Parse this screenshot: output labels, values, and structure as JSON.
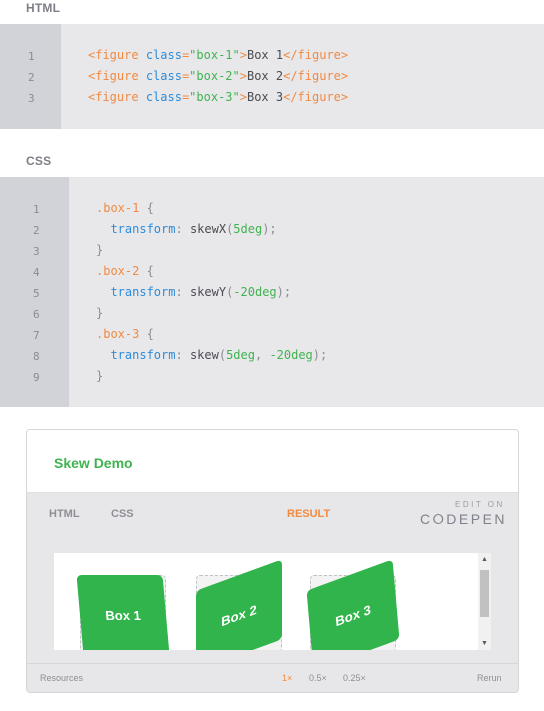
{
  "html_section": {
    "label": "HTML",
    "line_numbers": [
      "1",
      "2",
      "3"
    ],
    "lines": [
      [
        [
          "tok-tag",
          "<figure"
        ],
        [
          "tok-text",
          " "
        ],
        [
          "tok-attr",
          "class"
        ],
        [
          "tok-tag",
          "="
        ],
        [
          "tok-str",
          "\"box-1\""
        ],
        [
          "tok-tag",
          ">"
        ],
        [
          "tok-text",
          "Box 1"
        ],
        [
          "tok-tag",
          "</figure>"
        ]
      ],
      [
        [
          "tok-tag",
          "<figure"
        ],
        [
          "tok-text",
          " "
        ],
        [
          "tok-attr",
          "class"
        ],
        [
          "tok-tag",
          "="
        ],
        [
          "tok-str",
          "\"box-2\""
        ],
        [
          "tok-tag",
          ">"
        ],
        [
          "tok-text",
          "Box 2"
        ],
        [
          "tok-tag",
          "</figure>"
        ]
      ],
      [
        [
          "tok-tag",
          "<figure"
        ],
        [
          "tok-text",
          " "
        ],
        [
          "tok-attr",
          "class"
        ],
        [
          "tok-tag",
          "="
        ],
        [
          "tok-str",
          "\"box-3\""
        ],
        [
          "tok-tag",
          ">"
        ],
        [
          "tok-text",
          "Box 3"
        ],
        [
          "tok-tag",
          "</figure>"
        ]
      ]
    ]
  },
  "css_section": {
    "label": "CSS",
    "line_numbers": [
      "1",
      "2",
      "3",
      "4",
      "5",
      "6",
      "7",
      "8",
      "9"
    ],
    "lines": [
      [
        [
          "tok-sel",
          ".box-1"
        ],
        [
          "tok-punc",
          " {"
        ]
      ],
      [
        [
          "tok-text",
          "  "
        ],
        [
          "tok-prop",
          "transform"
        ],
        [
          "tok-punc",
          ": "
        ],
        [
          "tok-fn",
          "skewX"
        ],
        [
          "tok-punc",
          "("
        ],
        [
          "tok-num",
          "5deg"
        ],
        [
          "tok-punc",
          ");"
        ]
      ],
      [
        [
          "tok-punc",
          "}"
        ]
      ],
      [
        [
          "tok-sel",
          ".box-2"
        ],
        [
          "tok-punc",
          " {"
        ]
      ],
      [
        [
          "tok-text",
          "  "
        ],
        [
          "tok-prop",
          "transform"
        ],
        [
          "tok-punc",
          ": "
        ],
        [
          "tok-fn",
          "skewY"
        ],
        [
          "tok-punc",
          "("
        ],
        [
          "tok-num",
          "-20deg"
        ],
        [
          "tok-punc",
          ");"
        ]
      ],
      [
        [
          "tok-punc",
          "}"
        ]
      ],
      [
        [
          "tok-sel",
          ".box-3"
        ],
        [
          "tok-punc",
          " {"
        ]
      ],
      [
        [
          "tok-text",
          "  "
        ],
        [
          "tok-prop",
          "transform"
        ],
        [
          "tok-punc",
          ": "
        ],
        [
          "tok-fn",
          "skew"
        ],
        [
          "tok-punc",
          "("
        ],
        [
          "tok-num",
          "5deg"
        ],
        [
          "tok-punc",
          ", "
        ],
        [
          "tok-num",
          "-20deg"
        ],
        [
          "tok-punc",
          ");"
        ]
      ],
      [
        [
          "tok-punc",
          "}"
        ]
      ]
    ]
  },
  "demo": {
    "title": "Skew Demo",
    "tabs": {
      "html": "HTML",
      "css": "CSS",
      "result": "RESULT"
    },
    "codepen": {
      "edit_on": "EDIT ON",
      "logo": "C⭘DEPEN"
    },
    "boxes": [
      "Box 1",
      "Box 2",
      "Box 3"
    ],
    "footer": {
      "resources": "Resources",
      "zoom_1x": "1×",
      "zoom_05x": "0.5×",
      "zoom_025x": "0.25×",
      "rerun": "Rerun"
    }
  },
  "colors": {
    "accent_green": "#3fb34f",
    "box_green": "#31b44b",
    "accent_orange": "#f38a3d"
  },
  "icons": {
    "scroll_up": "triangle-up-icon",
    "scroll_down": "triangle-down-icon"
  }
}
